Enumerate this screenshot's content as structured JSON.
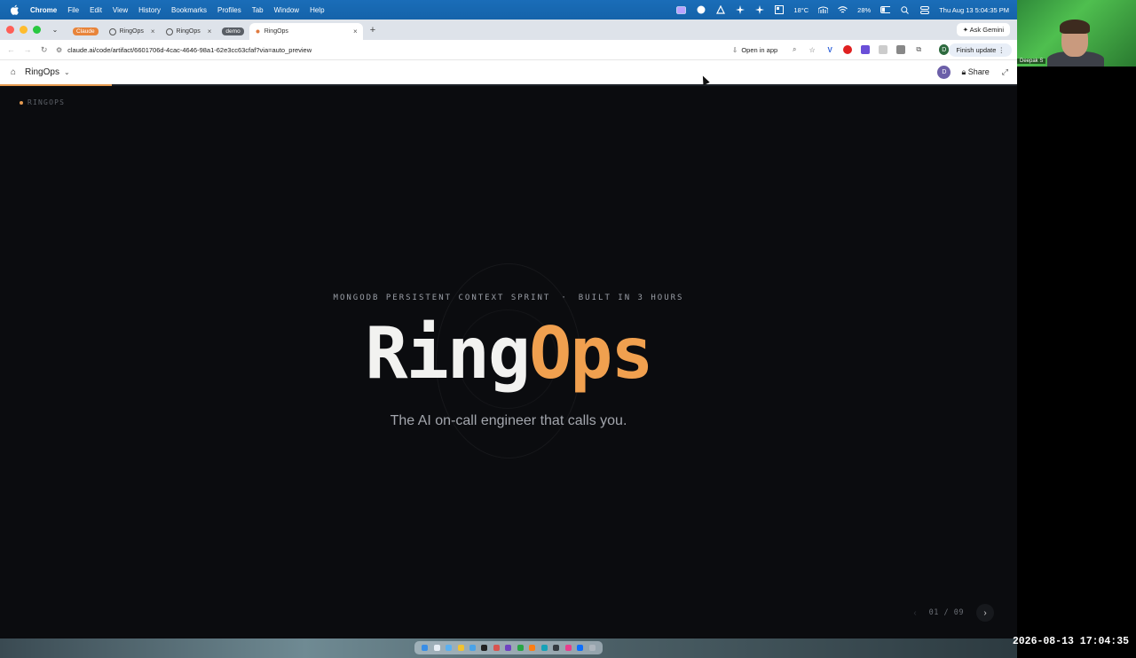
{
  "menubar": {
    "app_name": "Chrome",
    "items": [
      "File",
      "Edit",
      "View",
      "History",
      "Bookmarks",
      "Profiles",
      "Tab",
      "Window",
      "Help"
    ],
    "weather": "18°C",
    "battery": "28%",
    "datetime": "Thu Aug 13  5:04:35 PM"
  },
  "tabs": [
    {
      "label": "Claude",
      "style": "pill-orange"
    },
    {
      "label": "RingOps",
      "style": "normal"
    },
    {
      "label": "RingOps",
      "style": "normal"
    },
    {
      "label": "demo",
      "style": "pill-dark"
    },
    {
      "label": "RingOps",
      "style": "active"
    }
  ],
  "ask_gemini": "Ask Gemini",
  "address": {
    "url": "claude.ai/code/artifact/6601706d-4cac-4646-98a1-62e3cc63cfaf?via=auto_preview",
    "open_in_app": "Open in app",
    "finish_update": "Finish update",
    "profile_initial": "D"
  },
  "artifact_header": {
    "title": "RingOps",
    "avatar_initial": "D",
    "share_label": "Share"
  },
  "slide": {
    "brand": "RINGOPS",
    "eyebrow_left": "MONGODB PERSISTENT CONTEXT SPRINT",
    "eyebrow_sep": "·",
    "eyebrow_right": "BUILT IN 3 HOURS",
    "title_a": "Ring",
    "title_b": "Ops",
    "tagline": "The AI on-call engineer that calls you.",
    "counter": "01 / 09"
  },
  "webcam": {
    "participant": "Deepak S"
  },
  "recording_timestamp": "2026-08-13 17:04:35",
  "colors": {
    "accent": "#f0a04f",
    "slide_bg": "#0b0c0f",
    "menubar": "#1563aa"
  }
}
